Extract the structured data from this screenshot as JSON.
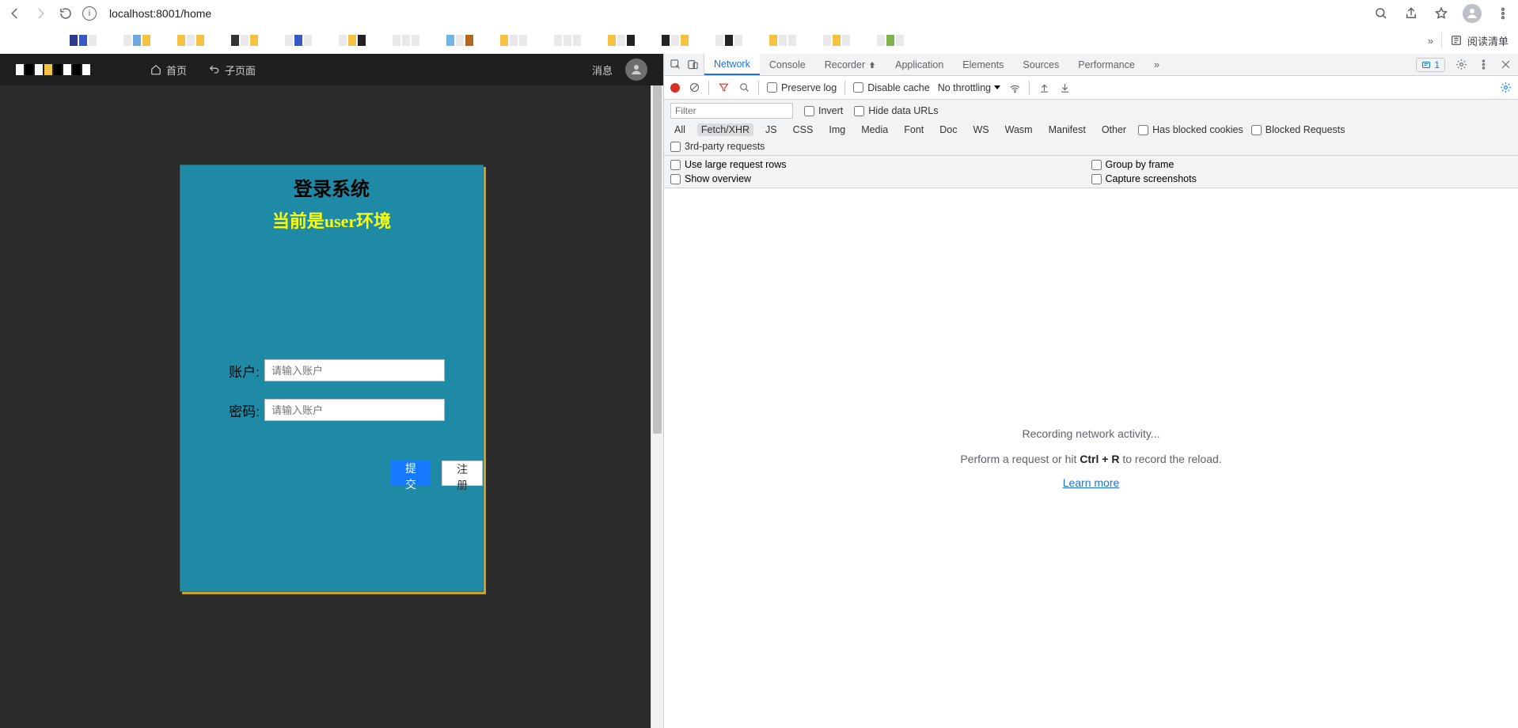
{
  "browser": {
    "url": "localhost:8001/home",
    "reading_list": "阅读清单"
  },
  "app": {
    "nav_home": "首页",
    "nav_sub": "子页面",
    "msg": "消息"
  },
  "login": {
    "title": "登录系统",
    "subtitle": "当前是user环境",
    "account_label": "账户:",
    "account_placeholder": "请输入账户",
    "password_label": "密码:",
    "password_placeholder": "请输入账户",
    "submit": "提 交",
    "register": "注 册"
  },
  "devtools": {
    "tabs": {
      "network": "Network",
      "console": "Console",
      "recorder": "Recorder",
      "application": "Application",
      "elements": "Elements",
      "sources": "Sources",
      "performance": "Performance"
    },
    "issues_count": "1",
    "toolbar": {
      "preserve_log": "Preserve log",
      "disable_cache": "Disable cache",
      "throttling": "No throttling"
    },
    "filter": {
      "placeholder": "Filter",
      "invert": "Invert",
      "hide_data_urls": "Hide data URLs",
      "types": [
        "All",
        "Fetch/XHR",
        "JS",
        "CSS",
        "Img",
        "Media",
        "Font",
        "Doc",
        "WS",
        "Wasm",
        "Manifest",
        "Other"
      ],
      "has_blocked_cookies": "Has blocked cookies",
      "blocked_requests": "Blocked Requests",
      "third_party": "3rd-party requests"
    },
    "viewopts": {
      "large_rows": "Use large request rows",
      "group_by_frame": "Group by frame",
      "show_overview": "Show overview",
      "capture_screenshots": "Capture screenshots"
    },
    "empty": {
      "line1": "Recording network activity...",
      "line2_a": "Perform a request or hit ",
      "line2_b": "Ctrl + R",
      "line2_c": " to record the reload.",
      "learn_more": "Learn more"
    }
  }
}
